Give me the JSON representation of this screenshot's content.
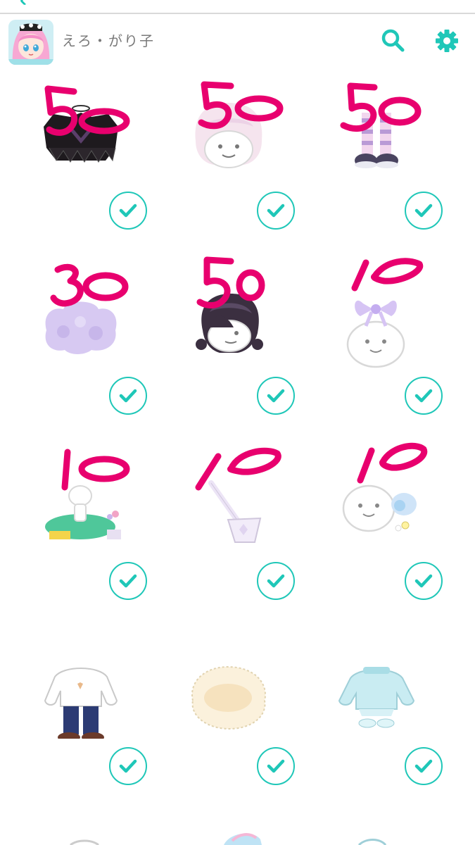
{
  "header": {
    "username": "えろ・がり子"
  },
  "icons": {
    "back": "chevron-left-icon",
    "close": "close-icon",
    "search": "search-icon",
    "settings": "gear-icon",
    "check": "checkmark-icon"
  },
  "colors": {
    "accent": "#1fc7b8",
    "handwriting": "#e8006e",
    "username_text": "#7a7a7a",
    "divider": "#d9d9d9"
  },
  "items": [
    {
      "price": "50",
      "item": "black-frilled-top",
      "selected": true
    },
    {
      "price": "50",
      "item": "pastel-bob-hair",
      "selected": true
    },
    {
      "price": "50",
      "item": "striped-socks-shoes",
      "selected": true
    },
    {
      "price": "30",
      "item": "lavender-fluffy-top",
      "selected": true
    },
    {
      "price": "50",
      "item": "dark-purple-hair",
      "selected": true
    },
    {
      "price": "10",
      "item": "lavender-hair-bow",
      "selected": true
    },
    {
      "price": "10",
      "item": "green-rug-accessories",
      "selected": true
    },
    {
      "price": "10",
      "item": "lilac-shoulder-bag",
      "selected": true
    },
    {
      "price": "10",
      "item": "pastel-hair-clip",
      "selected": true
    },
    {
      "price": "",
      "item": "butterfly-sweater-jeans",
      "selected": true
    },
    {
      "price": "",
      "item": "cream-fur-stole",
      "selected": true
    },
    {
      "price": "",
      "item": "mint-sweater-outfit",
      "selected": true
    }
  ]
}
